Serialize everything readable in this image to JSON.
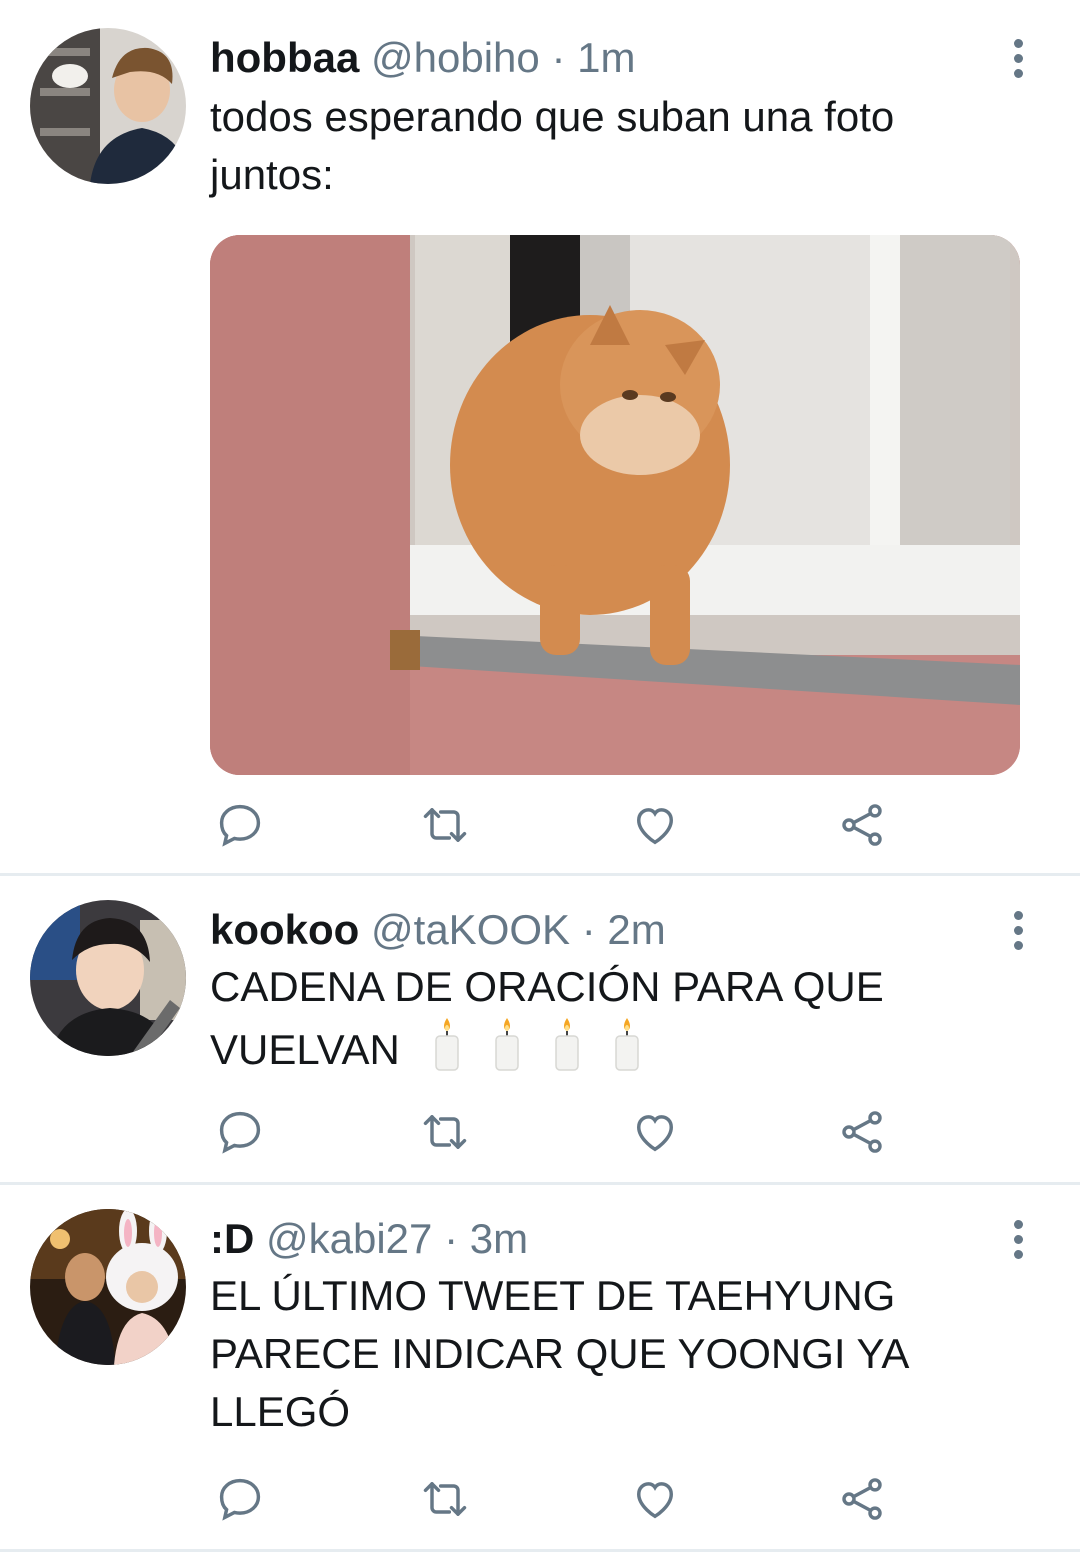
{
  "tweets": [
    {
      "author_name": "hobbaa",
      "handle": "@hobiho",
      "separator": "·",
      "time": "1m",
      "text_line1": "todos esperando que suban una foto",
      "text_line2": "juntos:",
      "has_media": true,
      "media_icon": "cat-in-window-photo"
    },
    {
      "author_name": "kookoo",
      "handle": "@taKOOK",
      "separator": "·",
      "time": "2m",
      "text_line1": "CADENA DE ORACIÓN PARA QUE",
      "text_line2": "VUELVAN",
      "candle_count": 4,
      "candle_icon": "candle-emoji"
    },
    {
      "author_name": ":D",
      "handle": "@kabi27",
      "separator": "·",
      "time": "3m",
      "text_line1": "EL ÚLTIMO TWEET DE TAEHYUNG",
      "text_line2": "PARECE INDICAR QUE YOONGI YA",
      "text_line3": "LLEGÓ"
    }
  ],
  "action_icons": [
    "reply-icon",
    "retweet-icon",
    "like-icon",
    "share-icon"
  ],
  "colors": {
    "text": "#14171a",
    "secondary": "#657786",
    "divider": "#e6ecf0",
    "background": "#ffffff"
  }
}
